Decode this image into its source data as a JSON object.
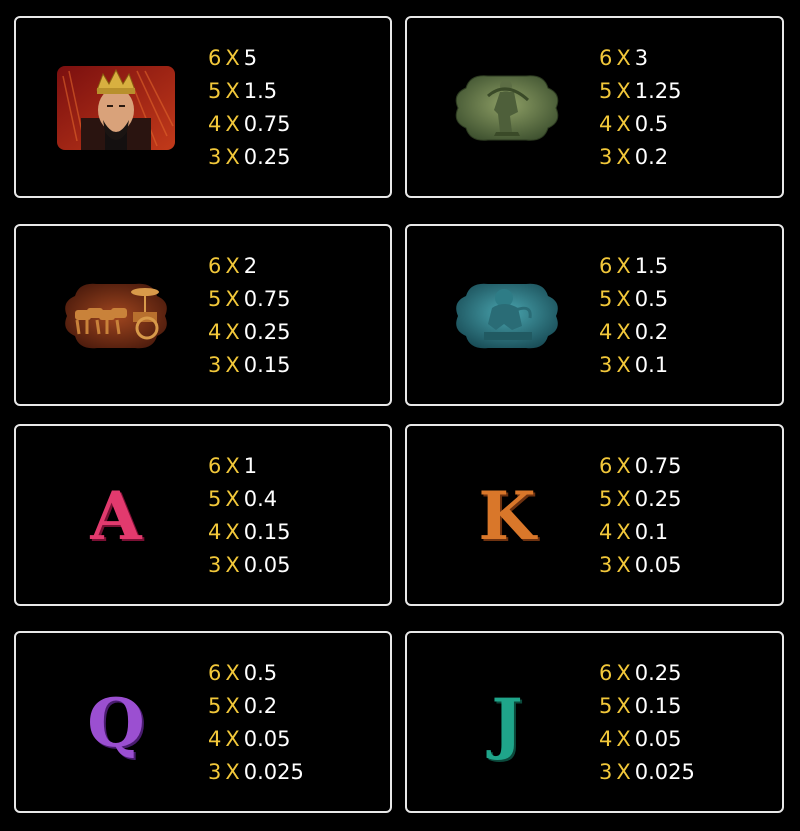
{
  "cards": [
    {
      "symbol": "emperor-portrait",
      "pays": [
        {
          "count": "6",
          "x": "X",
          "multiplier": "5"
        },
        {
          "count": "5",
          "x": "X",
          "multiplier": "1.5"
        },
        {
          "count": "4",
          "x": "X",
          "multiplier": "0.75"
        },
        {
          "count": "3",
          "x": "X",
          "multiplier": "0.25"
        }
      ]
    },
    {
      "symbol": "archer-warrior-statue",
      "pays": [
        {
          "count": "6",
          "x": "X",
          "multiplier": "3"
        },
        {
          "count": "5",
          "x": "X",
          "multiplier": "1.25"
        },
        {
          "count": "4",
          "x": "X",
          "multiplier": "0.5"
        },
        {
          "count": "3",
          "x": "X",
          "multiplier": "0.2"
        }
      ]
    },
    {
      "symbol": "bronze-chariot",
      "pays": [
        {
          "count": "6",
          "x": "X",
          "multiplier": "2"
        },
        {
          "count": "5",
          "x": "X",
          "multiplier": "0.75"
        },
        {
          "count": "4",
          "x": "X",
          "multiplier": "0.25"
        },
        {
          "count": "3",
          "x": "X",
          "multiplier": "0.15"
        }
      ]
    },
    {
      "symbol": "jade-beast-statue",
      "pays": [
        {
          "count": "6",
          "x": "X",
          "multiplier": "1.5"
        },
        {
          "count": "5",
          "x": "X",
          "multiplier": "0.5"
        },
        {
          "count": "4",
          "x": "X",
          "multiplier": "0.2"
        },
        {
          "count": "3",
          "x": "X",
          "multiplier": "0.1"
        }
      ]
    },
    {
      "symbol": "letter-a",
      "letter": "A",
      "color": "#e23a6e",
      "pays": [
        {
          "count": "6",
          "x": "X",
          "multiplier": "1"
        },
        {
          "count": "5",
          "x": "X",
          "multiplier": "0.4"
        },
        {
          "count": "4",
          "x": "X",
          "multiplier": "0.15"
        },
        {
          "count": "3",
          "x": "X",
          "multiplier": "0.05"
        }
      ]
    },
    {
      "symbol": "letter-k",
      "letter": "K",
      "color": "#d9772a",
      "pays": [
        {
          "count": "6",
          "x": "X",
          "multiplier": "0.75"
        },
        {
          "count": "5",
          "x": "X",
          "multiplier": "0.25"
        },
        {
          "count": "4",
          "x": "X",
          "multiplier": "0.1"
        },
        {
          "count": "3",
          "x": "X",
          "multiplier": "0.05"
        }
      ]
    },
    {
      "symbol": "letter-q",
      "letter": "Q",
      "color": "#9b4fd1",
      "pays": [
        {
          "count": "6",
          "x": "X",
          "multiplier": "0.5"
        },
        {
          "count": "5",
          "x": "X",
          "multiplier": "0.2"
        },
        {
          "count": "4",
          "x": "X",
          "multiplier": "0.05"
        },
        {
          "count": "3",
          "x": "X",
          "multiplier": "0.025"
        }
      ]
    },
    {
      "symbol": "letter-j",
      "letter": "J",
      "color": "#1fa58a",
      "pays": [
        {
          "count": "6",
          "x": "X",
          "multiplier": "0.25"
        },
        {
          "count": "5",
          "x": "X",
          "multiplier": "0.15"
        },
        {
          "count": "4",
          "x": "X",
          "multiplier": "0.05"
        },
        {
          "count": "3",
          "x": "X",
          "multiplier": "0.025"
        }
      ]
    }
  ],
  "colors": {
    "count": "#f2c83a",
    "multiplier": "#ffffff",
    "border": "#e8e8e8",
    "background": "#000000"
  }
}
